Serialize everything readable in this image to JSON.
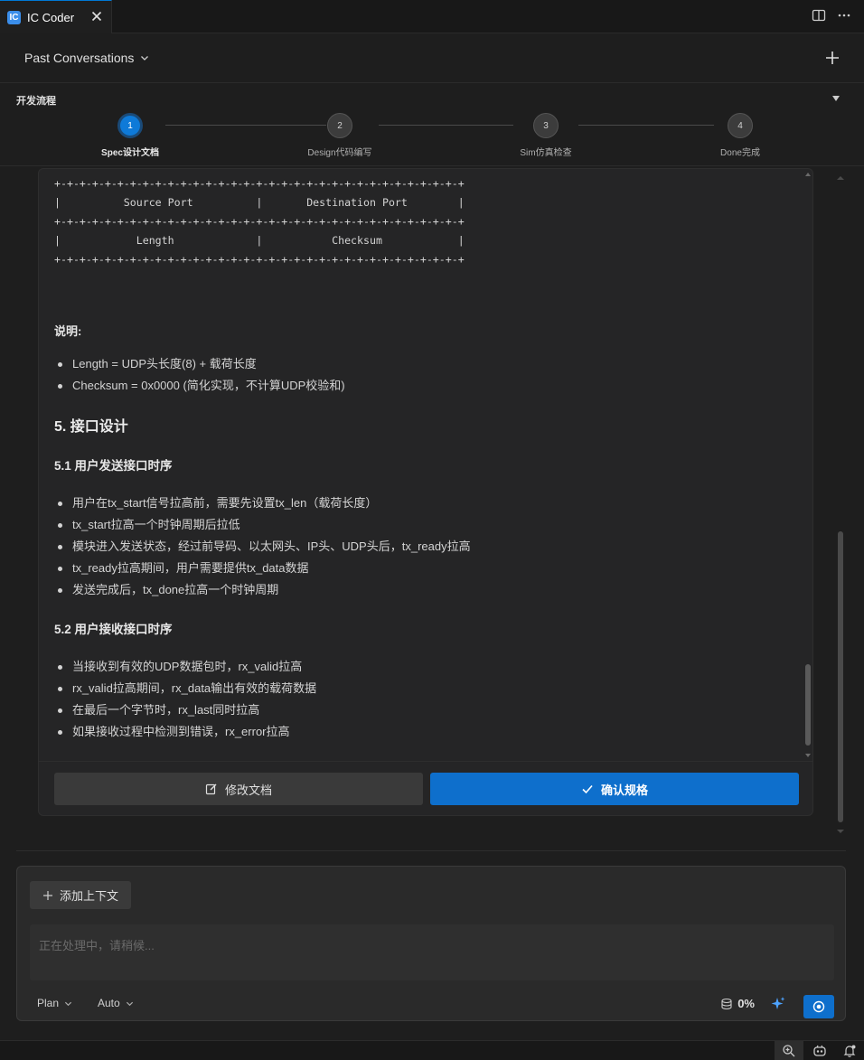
{
  "tab": {
    "title": "IC Coder",
    "logo_glyph": "IC"
  },
  "header": {
    "past_conversations": "Past Conversations"
  },
  "workflow": {
    "title": "开发流程",
    "steps": [
      {
        "num": "1",
        "label": "Spec设计文档",
        "active": true
      },
      {
        "num": "2",
        "label": "Design代码编写",
        "active": false
      },
      {
        "num": "3",
        "label": "Sim仿真检查",
        "active": false
      },
      {
        "num": "4",
        "label": "Done完成",
        "active": false
      }
    ]
  },
  "doc": {
    "header_table": "+-+-+-+-+-+-+-+-+-+-+-+-+-+-+-+-+-+-+-+-+-+-+-+-+-+-+-+-+-+-+-+-+\n|          Source Port          |       Destination Port        |\n+-+-+-+-+-+-+-+-+-+-+-+-+-+-+-+-+-+-+-+-+-+-+-+-+-+-+-+-+-+-+-+-+\n|            Length             |           Checksum            |\n+-+-+-+-+-+-+-+-+-+-+-+-+-+-+-+-+-+-+-+-+-+-+-+-+-+-+-+-+-+-+-+-+",
    "note_title": "说明:",
    "notes": [
      "Length = UDP头长度(8) + 载荷长度",
      "Checksum = 0x0000 (简化实现，不计算UDP校验和)"
    ],
    "section5_title": "5. 接口设计",
    "section51_title": "5.1 用户发送接口时序",
    "section51_items": [
      "用户在tx_start信号拉高前，需要先设置tx_len（载荷长度）",
      "tx_start拉高一个时钟周期后拉低",
      "模块进入发送状态，经过前导码、以太网头、IP头、UDP头后，tx_ready拉高",
      "tx_ready拉高期间，用户需要提供tx_data数据",
      "发送完成后，tx_done拉高一个时钟周期"
    ],
    "section52_title": "5.2 用户接收接口时序",
    "section52_items": [
      "当接收到有效的UDP数据包时，rx_valid拉高",
      "rx_valid拉高期间，rx_data输出有效的载荷数据",
      "在最后一个字节时，rx_last同时拉高",
      "如果接收过程中检测到错误，rx_error拉高"
    ]
  },
  "actions": {
    "edit_label": "修改文档",
    "confirm_label": "确认规格"
  },
  "input": {
    "add_context_label": "添加上下文",
    "placeholder": "正在处理中，请稍候...",
    "mode_label": "Plan",
    "model_label": "Auto",
    "usage_percent": "0%"
  },
  "colors": {
    "accent": "#0e6fcc",
    "background": "#1e1e1e"
  }
}
